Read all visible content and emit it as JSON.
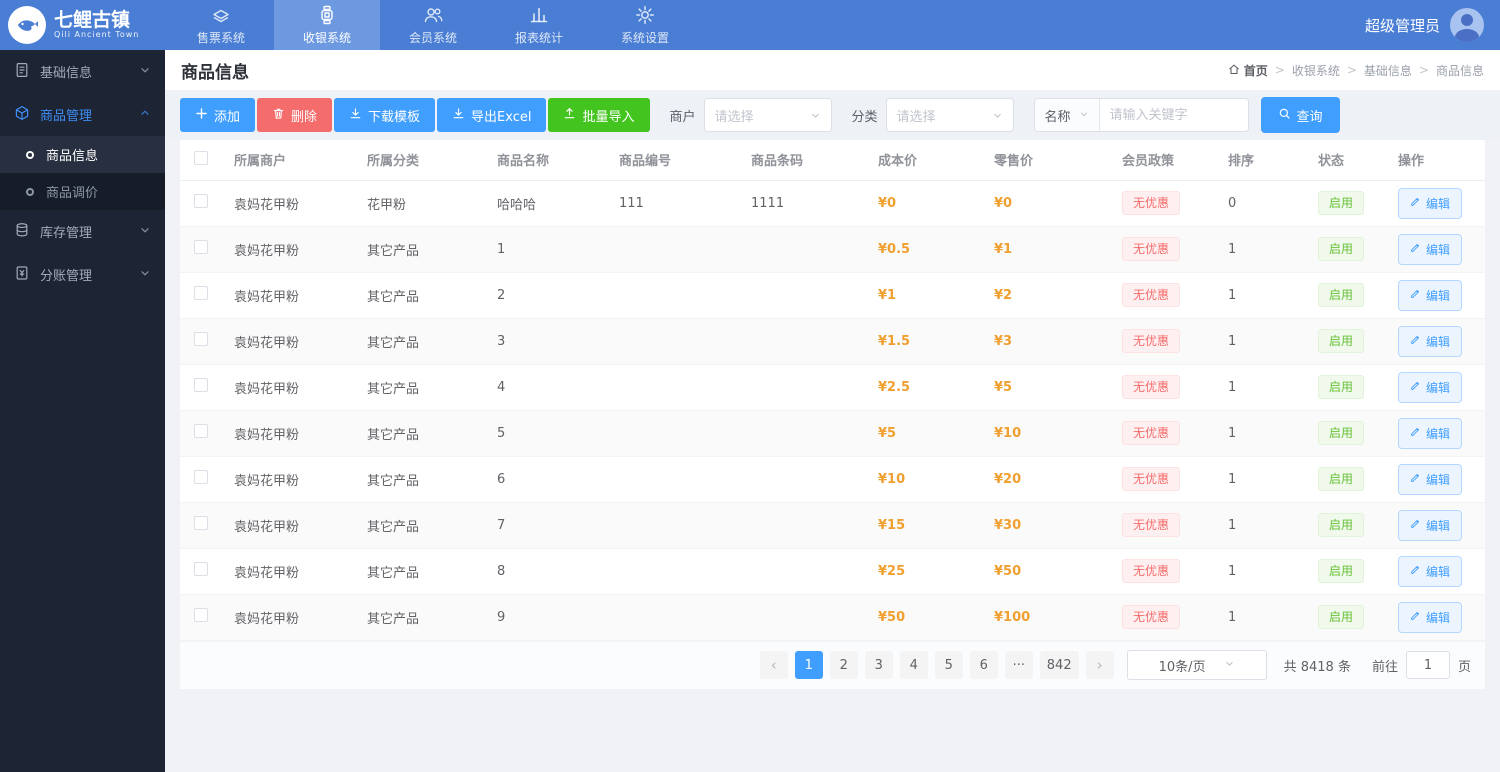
{
  "topbar": {
    "logo": {
      "title": "七鲤古镇",
      "subtitle": "Qili Ancient Town"
    },
    "tabs": [
      {
        "label": "售票系统",
        "icon": "ticket-icon",
        "active": false
      },
      {
        "label": "收银系统",
        "icon": "cashier-icon",
        "active": true
      },
      {
        "label": "会员系统",
        "icon": "member-icon",
        "active": false
      },
      {
        "label": "报表统计",
        "icon": "report-icon",
        "active": false
      },
      {
        "label": "系统设置",
        "icon": "settings-icon",
        "active": false
      }
    ],
    "user": {
      "name": "超级管理员"
    }
  },
  "sidebar": {
    "items": [
      {
        "label": "基础信息",
        "icon": "document-icon",
        "expanded": false
      },
      {
        "label": "商品管理",
        "icon": "cube-icon",
        "expanded": true
      },
      {
        "label": "库存管理",
        "icon": "inventory-icon",
        "expanded": false
      },
      {
        "label": "分账管理",
        "icon": "ledger-icon",
        "expanded": false
      }
    ],
    "goods_children": [
      {
        "label": "商品信息",
        "active": true
      },
      {
        "label": "商品调价",
        "active": false
      }
    ]
  },
  "page": {
    "title": "商品信息",
    "breadcrumb": {
      "home": "首页",
      "items": [
        "收银系统",
        "基础信息",
        "商品信息"
      ],
      "separator": ">"
    }
  },
  "toolbar": {
    "buttons": [
      {
        "label": "添加",
        "color": "#409eff"
      },
      {
        "label": "删除",
        "color": "#f56c6c"
      },
      {
        "label": "下载模板",
        "color": "#409eff"
      },
      {
        "label": "导出Excel",
        "color": "#409eff"
      },
      {
        "label": "批量导入",
        "color": "#44c41e"
      }
    ],
    "filters": {
      "merchant_label": "商户",
      "merchant_placeholder": "请选择",
      "category_label": "分类",
      "category_placeholder": "请选择",
      "name_label": "名称",
      "keyword_placeholder": "请输入关键字",
      "search_label": "查询"
    }
  },
  "table": {
    "columns": [
      "所属商户",
      "所属分类",
      "商品名称",
      "商品编号",
      "商品条码",
      "成本价",
      "零售价",
      "会员政策",
      "排序",
      "状态",
      "操作"
    ],
    "rows": [
      {
        "merchant": "袁妈花甲粉",
        "category": "花甲粉",
        "name": "哈哈哈",
        "code": "111",
        "barcode": "1111",
        "cost": "¥0",
        "price": "¥0",
        "policy": "无优惠",
        "sort": "0",
        "status": "启用",
        "action": "编辑"
      },
      {
        "merchant": "袁妈花甲粉",
        "category": "其它产品",
        "name": "1",
        "code": "",
        "barcode": "",
        "cost": "¥0.5",
        "price": "¥1",
        "policy": "无优惠",
        "sort": "1",
        "status": "启用",
        "action": "编辑"
      },
      {
        "merchant": "袁妈花甲粉",
        "category": "其它产品",
        "name": "2",
        "code": "",
        "barcode": "",
        "cost": "¥1",
        "price": "¥2",
        "policy": "无优惠",
        "sort": "1",
        "status": "启用",
        "action": "编辑"
      },
      {
        "merchant": "袁妈花甲粉",
        "category": "其它产品",
        "name": "3",
        "code": "",
        "barcode": "",
        "cost": "¥1.5",
        "price": "¥3",
        "policy": "无优惠",
        "sort": "1",
        "status": "启用",
        "action": "编辑"
      },
      {
        "merchant": "袁妈花甲粉",
        "category": "其它产品",
        "name": "4",
        "code": "",
        "barcode": "",
        "cost": "¥2.5",
        "price": "¥5",
        "policy": "无优惠",
        "sort": "1",
        "status": "启用",
        "action": "编辑"
      },
      {
        "merchant": "袁妈花甲粉",
        "category": "其它产品",
        "name": "5",
        "code": "",
        "barcode": "",
        "cost": "¥5",
        "price": "¥10",
        "policy": "无优惠",
        "sort": "1",
        "status": "启用",
        "action": "编辑"
      },
      {
        "merchant": "袁妈花甲粉",
        "category": "其它产品",
        "name": "6",
        "code": "",
        "barcode": "",
        "cost": "¥10",
        "price": "¥20",
        "policy": "无优惠",
        "sort": "1",
        "status": "启用",
        "action": "编辑"
      },
      {
        "merchant": "袁妈花甲粉",
        "category": "其它产品",
        "name": "7",
        "code": "",
        "barcode": "",
        "cost": "¥15",
        "price": "¥30",
        "policy": "无优惠",
        "sort": "1",
        "status": "启用",
        "action": "编辑"
      },
      {
        "merchant": "袁妈花甲粉",
        "category": "其它产品",
        "name": "8",
        "code": "",
        "barcode": "",
        "cost": "¥25",
        "price": "¥50",
        "policy": "无优惠",
        "sort": "1",
        "status": "启用",
        "action": "编辑"
      },
      {
        "merchant": "袁妈花甲粉",
        "category": "其它产品",
        "name": "9",
        "code": "",
        "barcode": "",
        "cost": "¥50",
        "price": "¥100",
        "policy": "无优惠",
        "sort": "1",
        "status": "启用",
        "action": "编辑"
      }
    ]
  },
  "pagination": {
    "prev": "‹",
    "next": "›",
    "pages": [
      "1",
      "2",
      "3",
      "4",
      "5",
      "6"
    ],
    "ellipsis": "···",
    "last_page": "842",
    "page_size": "10条/页",
    "total": "共 8418 条",
    "goto_label": "前往",
    "goto_value": "1",
    "goto_suffix": "页"
  },
  "colors": {
    "topbar": "#4a7ed4",
    "sidebar": "#1d2433",
    "accent": "#409eff",
    "danger": "#f56c6c",
    "success_button": "#44c41e",
    "price": "#efa030",
    "status_green": "#67c23a"
  }
}
